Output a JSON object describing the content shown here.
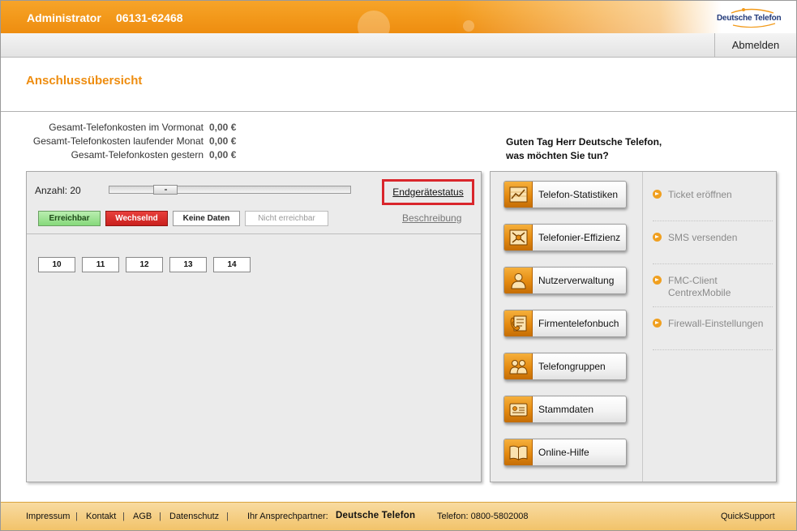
{
  "header": {
    "user": "Administrator",
    "phone": "06131-62468",
    "logo_text": "Deutsche Telefon"
  },
  "nav": {
    "logout_label": "Abmelden"
  },
  "page": {
    "title": "Anschlussübersicht"
  },
  "costs": [
    {
      "label": "Gesamt-Telefonkosten im Vormonat",
      "value": "0,00 €"
    },
    {
      "label": "Gesamt-Telefonkosten laufender Monat",
      "value": "0,00 €"
    },
    {
      "label": "Gesamt-Telefonkosten gestern",
      "value": "0,00 €"
    }
  ],
  "greeting": {
    "line1": "Guten Tag Herr Deutsche Telefon,",
    "line2": "was möchten Sie tun?"
  },
  "left_panel": {
    "anzahl_label": "Anzahl: 20",
    "slider_value": 20,
    "status_link": "Endgerätestatus",
    "legend": {
      "erreichbar": "Erreichbar",
      "wechselnd": "Wechselnd",
      "keine_daten": "Keine Daten",
      "nicht_erreichbar": "Nicht erreichbar"
    },
    "beschreibung": "Beschreibung",
    "numbers": [
      "10",
      "11",
      "12",
      "13",
      "14"
    ]
  },
  "actions": [
    {
      "label": "Telefon-Statistiken",
      "icon": "chart-icon"
    },
    {
      "label": "Telefonier-Effizienz",
      "icon": "efficiency-icon"
    },
    {
      "label": "Nutzerverwaltung",
      "icon": "user-icon"
    },
    {
      "label": "Firmentelefonbuch",
      "icon": "phonebook-icon"
    },
    {
      "label": "Telefongruppen",
      "icon": "group-icon"
    },
    {
      "label": "Stammdaten",
      "icon": "id-card-icon"
    },
    {
      "label": "Online-Hilfe",
      "icon": "book-icon"
    }
  ],
  "side_links": [
    {
      "label": "Ticket eröffnen"
    },
    {
      "label": "SMS versenden"
    },
    {
      "label": "FMC-Client CentrexMobile"
    },
    {
      "label": "Firewall-Einstellungen"
    }
  ],
  "footer": {
    "impressum": "Impressum",
    "kontakt": "Kontakt",
    "agb": "AGB",
    "datenschutz": "Datenschutz",
    "partner_label": "Ihr Ansprechpartner:",
    "partner_name": "Deutsche Telefon",
    "telefon": "Telefon: 0800-5802008",
    "quicksupport": "QuickSupport"
  },
  "colors": {
    "accent": "#ee8d10",
    "reachable": "#86d97b",
    "changing": "#c9201d",
    "highlight": "#d9262c",
    "footer": "#f2c36a"
  }
}
